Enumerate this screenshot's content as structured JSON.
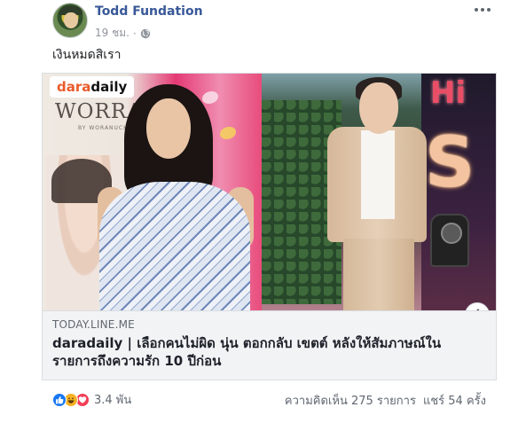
{
  "post": {
    "author": "Todd Fundation",
    "time": "19 ชม.",
    "time_separator": "·",
    "caption": "เงินหมดสิเรา",
    "more_icon": "ellipsis-horizontal-icon",
    "audience_icon": "globe-icon"
  },
  "link_card": {
    "logo_part1": "dara",
    "logo_part2": "daily",
    "image_text_brand": "WORRA",
    "image_text_sub": "BY WORANUCH",
    "domain": "TODAY.LINE.ME",
    "headline": "daradaily | เลือกคนไม่ผิด นุ่น ตอกกลับ เขตต์ หลังให้สัมภาษณ์ในรายการถึงความรัก 10 ปีก่อน",
    "info_label": "i"
  },
  "footer": {
    "reaction_icons": [
      "like-icon",
      "haha-icon",
      "love-icon"
    ],
    "reaction_count": "3.4 พัน",
    "comments": "ความคิดเห็น 275 รายการ",
    "shares": "แชร์ 54 ครั้ง"
  },
  "colors": {
    "name_link": "#385898",
    "meta_gray": "#90949c",
    "card_bg": "#f2f3f5",
    "like_blue": "#1877f2",
    "haha_yellow": "#f7b125",
    "love_red": "#f33e58",
    "logo_orange": "#ea5a2b"
  }
}
